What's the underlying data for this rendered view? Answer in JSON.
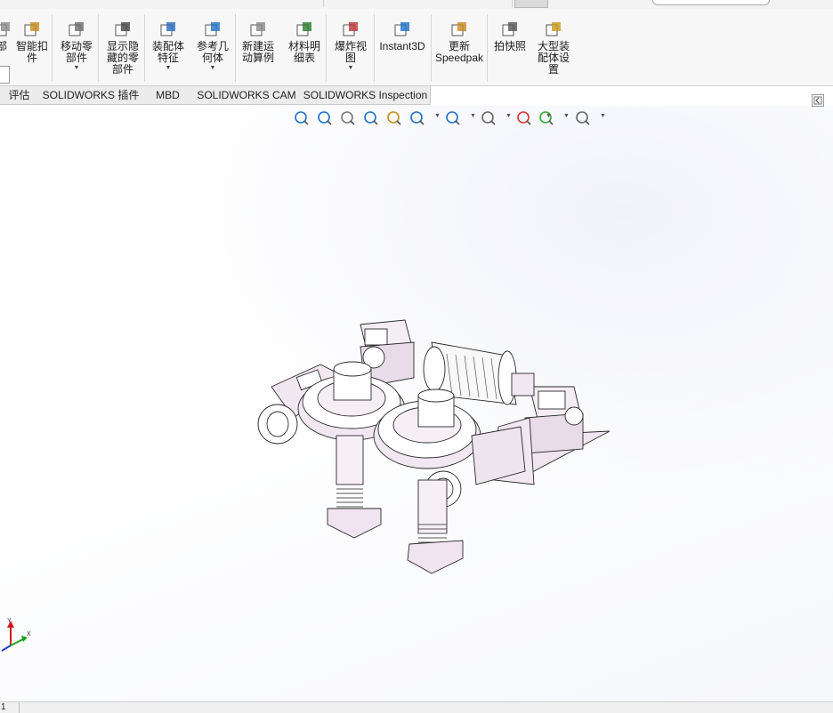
{
  "ribbon": {
    "items": [
      {
        "label": "部",
        "icon": "assembly-partial-icon",
        "dropdown": false
      },
      {
        "label": "智能扣\n件",
        "icon": "smart-fasteners-icon",
        "dropdown": false
      },
      {
        "label": "移动零\n部件",
        "icon": "move-component-icon",
        "dropdown": true
      },
      {
        "label": "显示隐\n藏的零\n部件",
        "icon": "show-hidden-components-icon",
        "dropdown": false
      },
      {
        "label": "装配体\n特征",
        "icon": "assembly-features-icon",
        "dropdown": true
      },
      {
        "label": "参考几\n何体",
        "icon": "reference-geometry-icon",
        "dropdown": true
      },
      {
        "label": "新建运\n动算例",
        "icon": "new-motion-study-icon",
        "dropdown": false
      },
      {
        "label": "材料明\n细表",
        "icon": "bill-of-materials-icon",
        "dropdown": false
      },
      {
        "label": "爆炸视\n图",
        "icon": "exploded-view-icon",
        "dropdown": true
      },
      {
        "label": "Instant3D",
        "icon": "instant3d-icon",
        "dropdown": false
      },
      {
        "label": "更新\nSpeedpak",
        "icon": "update-speedpak-icon",
        "dropdown": false
      },
      {
        "label": "拍快照",
        "icon": "take-snapshot-icon",
        "dropdown": false
      },
      {
        "label": "大型装\n配体设\n置",
        "icon": "large-assembly-settings-icon",
        "dropdown": false
      }
    ]
  },
  "tabs": [
    {
      "label": "评估"
    },
    {
      "label": "SOLIDWORKS 插件"
    },
    {
      "label": "MBD"
    },
    {
      "label": "SOLIDWORKS CAM"
    },
    {
      "label": "SOLIDWORKS Inspection"
    }
  ],
  "headsup": [
    {
      "icon": "zoom-to-fit-icon"
    },
    {
      "icon": "zoom-to-area-icon"
    },
    {
      "icon": "previous-view-icon"
    },
    {
      "icon": "section-view-icon"
    },
    {
      "icon": "dynamic-annotation-icon"
    },
    {
      "icon": "view-orientation-icon"
    },
    {
      "icon": "display-style-icon"
    },
    {
      "icon": "hide-show-items-icon"
    },
    {
      "icon": "edit-appearance-icon"
    },
    {
      "icon": "apply-scene-icon"
    },
    {
      "icon": "view-settings-icon"
    }
  ],
  "triad": {
    "x": "X",
    "y": "Y",
    "z": "Z"
  },
  "status": {
    "cell": "1"
  },
  "colors": {
    "ribbon_bg": "#f7f7f7",
    "tab_bg": "#ececec",
    "accent": "#1f6fc4",
    "model_face": "#ffffff",
    "model_shade": "#e6d6e6"
  }
}
